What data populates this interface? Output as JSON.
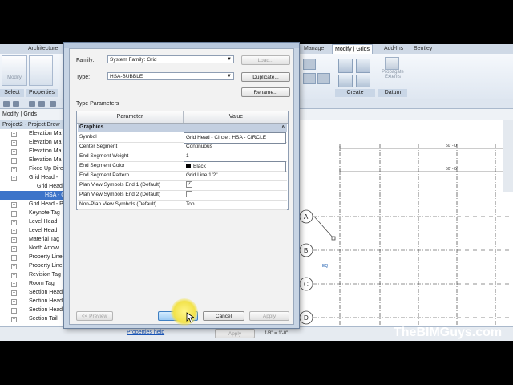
{
  "ribbon": {
    "tabs": [
      "Architecture",
      "Manage",
      "Modify | Grids",
      "Add-Ins",
      "Bentley"
    ],
    "buttons": [
      "Modify",
      "Properties"
    ],
    "groups": [
      "Select",
      "Properties",
      "Create",
      "Datum"
    ],
    "propagate_label": "Propagate Extents"
  },
  "options_bar": {
    "label": "Modify | Grids"
  },
  "project_browser": {
    "title": "Project2 - Project Brow",
    "items": [
      "Elevation Ma",
      "Elevation Ma",
      "Elevation Ma",
      "Elevation Ma",
      "Fixed Up Dire",
      "Grid Head - ",
      "Grid Head",
      "HSA - CIR",
      "Grid Head - P",
      "Keynote Tag",
      "Level Head",
      "Level Head",
      "Material Tag",
      "North Arrow",
      "Property Line",
      "Property Line",
      "Revision Tag",
      "Room Tag",
      "Section Head",
      "Section Head",
      "Section Head",
      "Section Tail"
    ]
  },
  "dialog": {
    "family_label": "Family:",
    "family_value": "System Family: Grid",
    "type_label": "Type:",
    "type_value": "HSA-BUBBLE",
    "load_button": "Load...",
    "duplicate_button": "Duplicate...",
    "rename_button": "Rename...",
    "type_parameters_label": "Type Parameters",
    "col_parameter": "Parameter",
    "col_value": "Value",
    "section": "Graphics",
    "rows": [
      {
        "param": "Symbol",
        "value": "Grid Head - Circle : HSA - CIRCLE"
      },
      {
        "param": "Center Segment",
        "value": "Continuous"
      },
      {
        "param": "End Segment Weight",
        "value": "1"
      },
      {
        "param": "End Segment Color",
        "value": "Black"
      },
      {
        "param": "End Segment Pattern",
        "value": "Grid Line 1/2\""
      },
      {
        "param": "Plan View Symbols End 1 (Default)",
        "value": ""
      },
      {
        "param": "Plan View Symbols End 2 (Default)",
        "value": ""
      },
      {
        "param": "Non-Plan View Symbols (Default)",
        "value": "Top"
      }
    ],
    "preview_button": "<< Preview",
    "ok_button": "OK",
    "cancel_button": "Cancel",
    "apply_button": "Apply"
  },
  "canvas": {
    "dim1": "50' - 0\"",
    "dim2": "50' - 0\"",
    "grid_labels": [
      "A",
      "B",
      "C",
      "D"
    ],
    "eq_label": "EQ"
  },
  "status": {
    "properties_help": "Properties help",
    "apply": "Apply",
    "scale": "1/8\" = 1'-0\""
  },
  "watermark": "TheBIMGuys.com"
}
